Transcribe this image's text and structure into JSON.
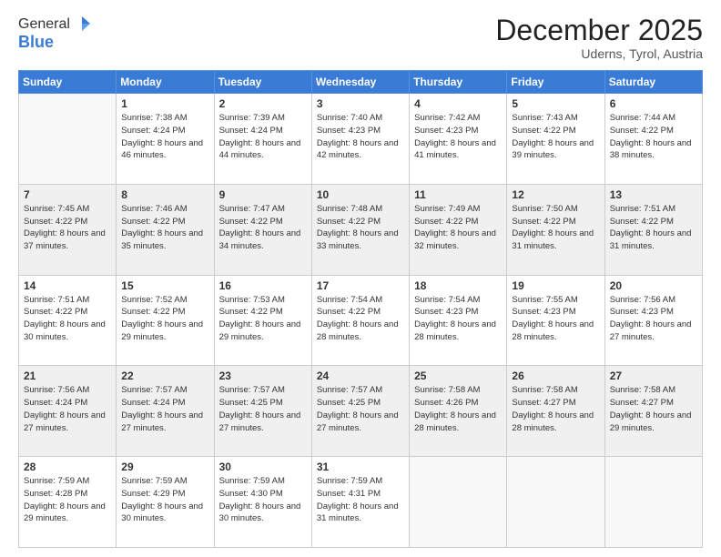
{
  "logo": {
    "general": "General",
    "blue": "Blue"
  },
  "header": {
    "month": "December 2025",
    "location": "Uderns, Tyrol, Austria"
  },
  "weekdays": [
    "Sunday",
    "Monday",
    "Tuesday",
    "Wednesday",
    "Thursday",
    "Friday",
    "Saturday"
  ],
  "weeks": [
    [
      {
        "day": "",
        "sunrise": "",
        "sunset": "",
        "daylight": ""
      },
      {
        "day": "1",
        "sunrise": "Sunrise: 7:38 AM",
        "sunset": "Sunset: 4:24 PM",
        "daylight": "Daylight: 8 hours and 46 minutes."
      },
      {
        "day": "2",
        "sunrise": "Sunrise: 7:39 AM",
        "sunset": "Sunset: 4:24 PM",
        "daylight": "Daylight: 8 hours and 44 minutes."
      },
      {
        "day": "3",
        "sunrise": "Sunrise: 7:40 AM",
        "sunset": "Sunset: 4:23 PM",
        "daylight": "Daylight: 8 hours and 42 minutes."
      },
      {
        "day": "4",
        "sunrise": "Sunrise: 7:42 AM",
        "sunset": "Sunset: 4:23 PM",
        "daylight": "Daylight: 8 hours and 41 minutes."
      },
      {
        "day": "5",
        "sunrise": "Sunrise: 7:43 AM",
        "sunset": "Sunset: 4:22 PM",
        "daylight": "Daylight: 8 hours and 39 minutes."
      },
      {
        "day": "6",
        "sunrise": "Sunrise: 7:44 AM",
        "sunset": "Sunset: 4:22 PM",
        "daylight": "Daylight: 8 hours and 38 minutes."
      }
    ],
    [
      {
        "day": "7",
        "sunrise": "Sunrise: 7:45 AM",
        "sunset": "Sunset: 4:22 PM",
        "daylight": "Daylight: 8 hours and 37 minutes."
      },
      {
        "day": "8",
        "sunrise": "Sunrise: 7:46 AM",
        "sunset": "Sunset: 4:22 PM",
        "daylight": "Daylight: 8 hours and 35 minutes."
      },
      {
        "day": "9",
        "sunrise": "Sunrise: 7:47 AM",
        "sunset": "Sunset: 4:22 PM",
        "daylight": "Daylight: 8 hours and 34 minutes."
      },
      {
        "day": "10",
        "sunrise": "Sunrise: 7:48 AM",
        "sunset": "Sunset: 4:22 PM",
        "daylight": "Daylight: 8 hours and 33 minutes."
      },
      {
        "day": "11",
        "sunrise": "Sunrise: 7:49 AM",
        "sunset": "Sunset: 4:22 PM",
        "daylight": "Daylight: 8 hours and 32 minutes."
      },
      {
        "day": "12",
        "sunrise": "Sunrise: 7:50 AM",
        "sunset": "Sunset: 4:22 PM",
        "daylight": "Daylight: 8 hours and 31 minutes."
      },
      {
        "day": "13",
        "sunrise": "Sunrise: 7:51 AM",
        "sunset": "Sunset: 4:22 PM",
        "daylight": "Daylight: 8 hours and 31 minutes."
      }
    ],
    [
      {
        "day": "14",
        "sunrise": "Sunrise: 7:51 AM",
        "sunset": "Sunset: 4:22 PM",
        "daylight": "Daylight: 8 hours and 30 minutes."
      },
      {
        "day": "15",
        "sunrise": "Sunrise: 7:52 AM",
        "sunset": "Sunset: 4:22 PM",
        "daylight": "Daylight: 8 hours and 29 minutes."
      },
      {
        "day": "16",
        "sunrise": "Sunrise: 7:53 AM",
        "sunset": "Sunset: 4:22 PM",
        "daylight": "Daylight: 8 hours and 29 minutes."
      },
      {
        "day": "17",
        "sunrise": "Sunrise: 7:54 AM",
        "sunset": "Sunset: 4:22 PM",
        "daylight": "Daylight: 8 hours and 28 minutes."
      },
      {
        "day": "18",
        "sunrise": "Sunrise: 7:54 AM",
        "sunset": "Sunset: 4:23 PM",
        "daylight": "Daylight: 8 hours and 28 minutes."
      },
      {
        "day": "19",
        "sunrise": "Sunrise: 7:55 AM",
        "sunset": "Sunset: 4:23 PM",
        "daylight": "Daylight: 8 hours and 28 minutes."
      },
      {
        "day": "20",
        "sunrise": "Sunrise: 7:56 AM",
        "sunset": "Sunset: 4:23 PM",
        "daylight": "Daylight: 8 hours and 27 minutes."
      }
    ],
    [
      {
        "day": "21",
        "sunrise": "Sunrise: 7:56 AM",
        "sunset": "Sunset: 4:24 PM",
        "daylight": "Daylight: 8 hours and 27 minutes."
      },
      {
        "day": "22",
        "sunrise": "Sunrise: 7:57 AM",
        "sunset": "Sunset: 4:24 PM",
        "daylight": "Daylight: 8 hours and 27 minutes."
      },
      {
        "day": "23",
        "sunrise": "Sunrise: 7:57 AM",
        "sunset": "Sunset: 4:25 PM",
        "daylight": "Daylight: 8 hours and 27 minutes."
      },
      {
        "day": "24",
        "sunrise": "Sunrise: 7:57 AM",
        "sunset": "Sunset: 4:25 PM",
        "daylight": "Daylight: 8 hours and 27 minutes."
      },
      {
        "day": "25",
        "sunrise": "Sunrise: 7:58 AM",
        "sunset": "Sunset: 4:26 PM",
        "daylight": "Daylight: 8 hours and 28 minutes."
      },
      {
        "day": "26",
        "sunrise": "Sunrise: 7:58 AM",
        "sunset": "Sunset: 4:27 PM",
        "daylight": "Daylight: 8 hours and 28 minutes."
      },
      {
        "day": "27",
        "sunrise": "Sunrise: 7:58 AM",
        "sunset": "Sunset: 4:27 PM",
        "daylight": "Daylight: 8 hours and 29 minutes."
      }
    ],
    [
      {
        "day": "28",
        "sunrise": "Sunrise: 7:59 AM",
        "sunset": "Sunset: 4:28 PM",
        "daylight": "Daylight: 8 hours and 29 minutes."
      },
      {
        "day": "29",
        "sunrise": "Sunrise: 7:59 AM",
        "sunset": "Sunset: 4:29 PM",
        "daylight": "Daylight: 8 hours and 30 minutes."
      },
      {
        "day": "30",
        "sunrise": "Sunrise: 7:59 AM",
        "sunset": "Sunset: 4:30 PM",
        "daylight": "Daylight: 8 hours and 30 minutes."
      },
      {
        "day": "31",
        "sunrise": "Sunrise: 7:59 AM",
        "sunset": "Sunset: 4:31 PM",
        "daylight": "Daylight: 8 hours and 31 minutes."
      },
      {
        "day": "",
        "sunrise": "",
        "sunset": "",
        "daylight": ""
      },
      {
        "day": "",
        "sunrise": "",
        "sunset": "",
        "daylight": ""
      },
      {
        "day": "",
        "sunrise": "",
        "sunset": "",
        "daylight": ""
      }
    ]
  ]
}
